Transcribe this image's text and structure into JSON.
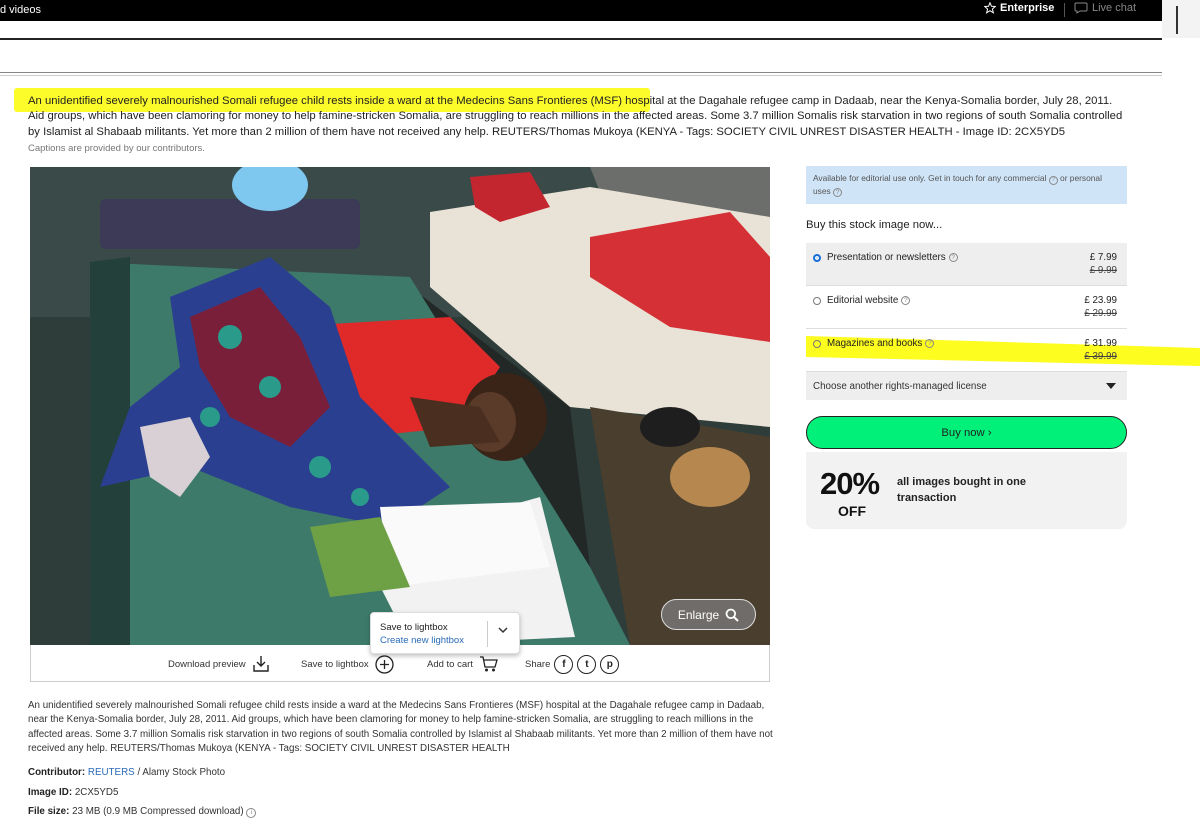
{
  "topbar": {
    "left_text": "d videos",
    "enterprise": "Enterprise",
    "live_chat": "Live chat"
  },
  "caption": {
    "highlighted": "An unidentified severely malnourished Somali refugee child rests inside a ward at the Medecins Sans Frontieres (MSF) hos",
    "rest": "pital at the Dagahale refugee camp in Dadaab, near the Kenya-Somalia border, July 28, 2011. Aid groups, which have been clamoring for money to help famine-stricken Somalia, are struggling to reach millions in the affected areas. Some 3.7 million Somalis risk starvation in two regions of south Somalia controlled by Islamist al Shabaab militants. Yet more than 2 million of them have not received any help. REUTERS/Thomas Mukoya (KENYA - Tags: SOCIETY CIVIL UNREST DISASTER HEALTH - Image ID: 2CX5YD5",
    "note": "Captions are provided by our contributors."
  },
  "photo": {
    "enlarge": "Enlarge"
  },
  "lightbox_popup": {
    "save": "Save to lightbox",
    "create": "Create new lightbox"
  },
  "actions": {
    "download": "Download preview",
    "save": "Save to lightbox",
    "cart": "Add to cart",
    "share": "Share",
    "share_icons": [
      "f",
      "t",
      "p"
    ]
  },
  "description": "An unidentified severely malnourished Somali refugee child rests inside a ward at the Medecins Sans Frontieres (MSF) hospital at the Dagahale refugee camp in Dadaab, near the Kenya-Somalia border, July 28, 2011. Aid groups, which have been clamoring for money to help famine-stricken Somalia, are struggling to reach millions in the affected areas. Some 3.7 million Somalis risk starvation in two regions of south Somalia controlled by Islamist al Shabaab militants. Yet more than 2 million of them have not received any help. REUTERS/Thomas Mukoya (KENYA - Tags: SOCIETY CIVIL UNREST DISASTER HEALTH",
  "meta": {
    "contributor_label": "Contributor:",
    "contributor_link": "REUTERS",
    "contributor_rest": "/ Alamy Stock Photo",
    "image_id_label": "Image ID:",
    "image_id": "2CX5YD5",
    "file_size_label": "File size:",
    "file_size": "23 MB (0.9 MB Compressed download)"
  },
  "panel": {
    "notice": "Available for editorial use only. Get in touch for any commercial",
    "notice2": "or personal uses",
    "buy_title": "Buy this stock image now...",
    "options": [
      {
        "label": "Presentation or newsletters",
        "price": "£ 7.99",
        "was": "£ 9.99",
        "selected": true
      },
      {
        "label": "Editorial website",
        "price": "£ 23.99",
        "was": "£ 29.99",
        "selected": false
      },
      {
        "label": "Magazines and books",
        "price": "£ 31.99",
        "was": "£ 39.99",
        "selected": false
      }
    ],
    "license": "Choose another rights-managed license",
    "buy_now": "Buy now ›",
    "promo_pct": "20%",
    "promo_off": "OFF",
    "promo_text": "all images bought in one transaction"
  },
  "colors": {
    "highlight": "#ffff33",
    "buy_button": "#00f07a",
    "link": "#2a6bb8",
    "notice_bg": "#cfe4f7"
  }
}
